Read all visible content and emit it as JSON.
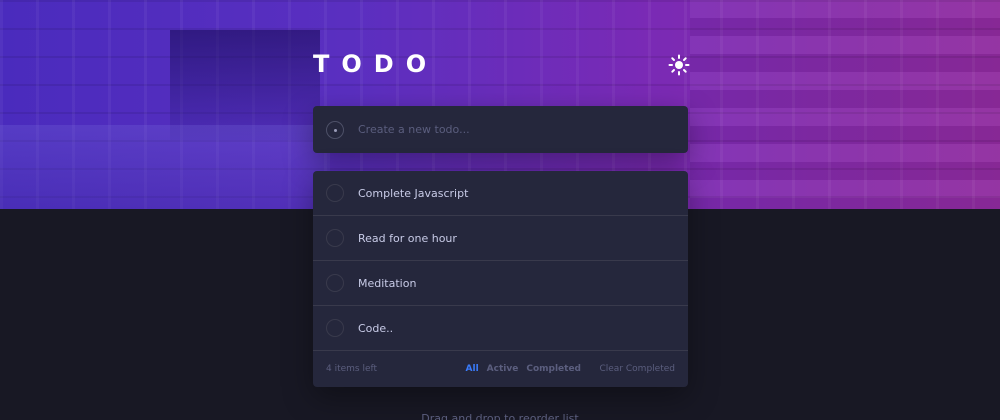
{
  "header": {
    "title": "TODO",
    "theme_icon": "sun-icon"
  },
  "new_todo": {
    "placeholder": "Create a new todo..."
  },
  "todos": [
    {
      "text": "Complete Javascript"
    },
    {
      "text": "Read for one hour"
    },
    {
      "text": "Meditation"
    },
    {
      "text": "Code.."
    }
  ],
  "footer": {
    "items_left": "4 items left",
    "filters": {
      "all": "All",
      "active": "Active",
      "completed": "Completed"
    },
    "clear": "Clear Completed"
  },
  "hint": "Drag and drop to reorder list",
  "colors": {
    "background": "#181824",
    "panel": "#25273c",
    "accent": "#3a7cfd",
    "hero_start": "#4a2bbd",
    "hero_end": "#8f2a9e"
  }
}
